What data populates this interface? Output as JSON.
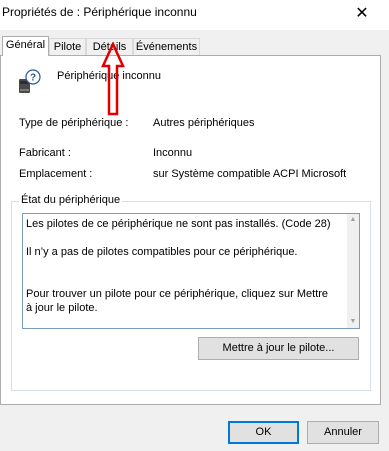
{
  "window": {
    "title": "Propriétés de : Périphérique inconnu",
    "close_glyph": "✕"
  },
  "tabs": [
    {
      "label": "Général",
      "active": true
    },
    {
      "label": "Pilote",
      "active": false
    },
    {
      "label": "Détails",
      "active": false
    },
    {
      "label": "Événements",
      "active": false
    }
  ],
  "device": {
    "name": "Périphérique inconnu",
    "icon": "unknown-device-icon"
  },
  "properties": [
    {
      "label": "Type de périphérique :",
      "value": "Autres périphériques"
    },
    {
      "label": "Fabricant :",
      "value": "Inconnu"
    },
    {
      "label": "Emplacement :",
      "value": "sur Système compatible ACPI Microsoft"
    }
  ],
  "status": {
    "legend": "État du périphérique",
    "lines": [
      "Les pilotes de ce périphérique ne sont pas installés. (Code 28)",
      "Il n’y a pas de pilotes compatibles pour ce périphérique.",
      "Pour trouver un pilote pour ce périphérique, cliquez sur Mettre à jour le pilote."
    ]
  },
  "buttons": {
    "update_driver": "Mettre à jour le pilote...",
    "ok": "OK",
    "cancel": "Annuler"
  },
  "colors": {
    "annotation_arrow": "#e00000",
    "default_button_border": "#0078d7"
  }
}
